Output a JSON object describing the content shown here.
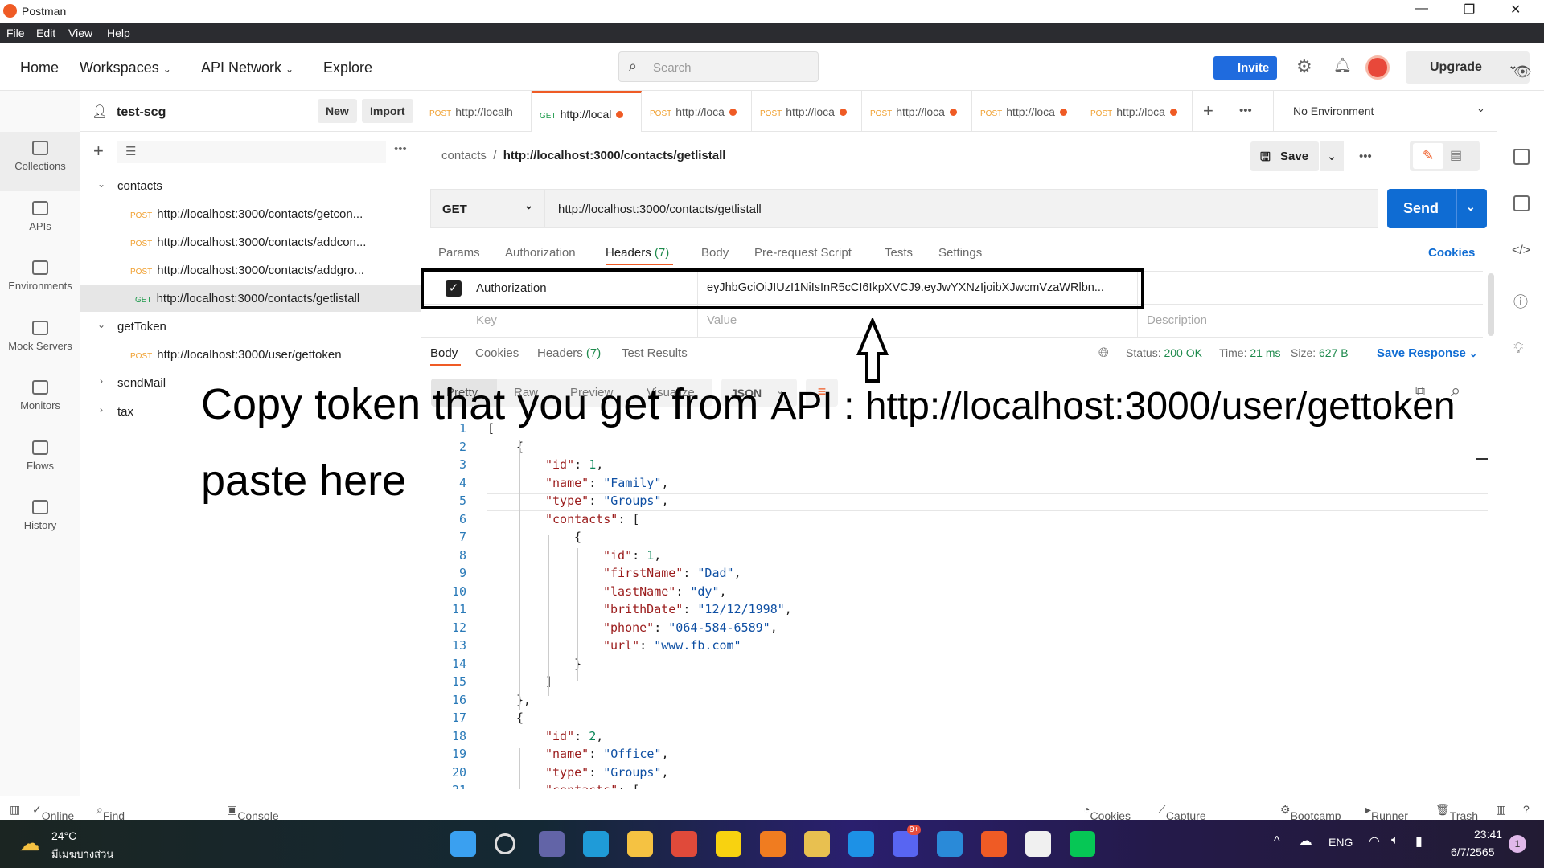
{
  "window": {
    "title": "Postman",
    "menu": [
      "File",
      "Edit",
      "View",
      "Help"
    ]
  },
  "header": {
    "nav": [
      "Home",
      "Workspaces",
      "API Network",
      "Explore"
    ],
    "search_placeholder": "Search",
    "invite": "Invite",
    "upgrade": "Upgrade"
  },
  "rail": [
    {
      "label": "Collections",
      "icon": "collections-icon"
    },
    {
      "label": "APIs",
      "icon": "apis-icon"
    },
    {
      "label": "Environments",
      "icon": "environments-icon"
    },
    {
      "label": "Mock Servers",
      "icon": "mock-servers-icon"
    },
    {
      "label": "Monitors",
      "icon": "monitors-icon"
    },
    {
      "label": "Flows",
      "icon": "flows-icon"
    },
    {
      "label": "History",
      "icon": "history-icon"
    }
  ],
  "workspace": {
    "name": "test-scg",
    "new": "New",
    "import": "Import"
  },
  "tree": [
    {
      "type": "folder",
      "label": "contacts",
      "open": true
    },
    {
      "type": "req",
      "method": "POST",
      "label": "http://localhost:3000/contacts/getcon..."
    },
    {
      "type": "req",
      "method": "POST",
      "label": "http://localhost:3000/contacts/addcon..."
    },
    {
      "type": "req",
      "method": "POST",
      "label": "http://localhost:3000/contacts/addgro..."
    },
    {
      "type": "req",
      "method": "GET",
      "label": "http://localhost:3000/contacts/getlistall",
      "selected": true
    },
    {
      "type": "folder",
      "label": "getToken",
      "open": true
    },
    {
      "type": "req",
      "method": "POST",
      "label": "http://localhost:3000/user/gettoken"
    },
    {
      "type": "folder",
      "label": "sendMail",
      "open": false
    },
    {
      "type": "folder",
      "label": "tax",
      "open": false
    }
  ],
  "tabs": [
    {
      "method": "POST",
      "label": "http://localh"
    },
    {
      "method": "GET",
      "label": "http://local",
      "active": true
    },
    {
      "method": "POST",
      "label": "http://loca"
    },
    {
      "method": "POST",
      "label": "http://loca"
    },
    {
      "method": "POST",
      "label": "http://loca"
    },
    {
      "method": "POST",
      "label": "http://loca"
    },
    {
      "method": "POST",
      "label": "http://loca"
    }
  ],
  "environment": "No Environment",
  "request": {
    "breadcrumb_parent": "contacts",
    "breadcrumb_current": "http://localhost:3000/contacts/getlistall",
    "save": "Save",
    "method": "GET",
    "url": "http://localhost:3000/contacts/getlistall",
    "send": "Send",
    "tabs": [
      "Params",
      "Authorization",
      "Headers",
      "Body",
      "Pre-request Script",
      "Tests",
      "Settings"
    ],
    "headers_count": "(7)",
    "cookies": "Cookies",
    "header_row": {
      "checked": true,
      "key": "Authorization",
      "value": "eyJhbGciOiJIUzI1NiIsInR5cCI6IkpXVCJ9.eyJwYXNzIjoibXJwcmVzaWRlbn..."
    },
    "placeholders": {
      "key": "Key",
      "value": "Value",
      "description": "Description"
    }
  },
  "response": {
    "tabs": [
      "Body",
      "Cookies",
      "Headers",
      "Test Results"
    ],
    "headers_count": "(7)",
    "status_label": "Status:",
    "status": "200 OK",
    "time_label": "Time:",
    "time": "21 ms",
    "size_label": "Size:",
    "size": "627 B",
    "save": "Save Response",
    "views": [
      "Pretty",
      "Raw",
      "Preview",
      "Visualize"
    ],
    "format": "JSON",
    "lines": [
      [
        0,
        [
          [
            "[",
            "p"
          ]
        ]
      ],
      [
        1,
        [
          [
            "{",
            "p"
          ]
        ]
      ],
      [
        2,
        [
          [
            "\"id\"",
            "k"
          ],
          [
            ": ",
            "p"
          ],
          [
            "1",
            "n"
          ],
          [
            ",",
            "p"
          ]
        ]
      ],
      [
        2,
        [
          [
            "\"name\"",
            "k"
          ],
          [
            ": ",
            "p"
          ],
          [
            "\"Family\"",
            "s"
          ],
          [
            ",",
            "p"
          ]
        ]
      ],
      [
        2,
        [
          [
            "\"type\"",
            "k"
          ],
          [
            ": ",
            "p"
          ],
          [
            "\"Groups\"",
            "s"
          ],
          [
            ",",
            "p"
          ]
        ]
      ],
      [
        2,
        [
          [
            "\"contacts\"",
            "k"
          ],
          [
            ": [",
            "p"
          ]
        ]
      ],
      [
        3,
        [
          [
            "{",
            "p"
          ]
        ]
      ],
      [
        4,
        [
          [
            "\"id\"",
            "k"
          ],
          [
            ": ",
            "p"
          ],
          [
            "1",
            "n"
          ],
          [
            ",",
            "p"
          ]
        ]
      ],
      [
        4,
        [
          [
            "\"firstName\"",
            "k"
          ],
          [
            ": ",
            "p"
          ],
          [
            "\"Dad\"",
            "s"
          ],
          [
            ",",
            "p"
          ]
        ]
      ],
      [
        4,
        [
          [
            "\"lastName\"",
            "k"
          ],
          [
            ": ",
            "p"
          ],
          [
            "\"dy\"",
            "s"
          ],
          [
            ",",
            "p"
          ]
        ]
      ],
      [
        4,
        [
          [
            "\"brithDate\"",
            "k"
          ],
          [
            ": ",
            "p"
          ],
          [
            "\"12/12/1998\"",
            "s"
          ],
          [
            ",",
            "p"
          ]
        ]
      ],
      [
        4,
        [
          [
            "\"phone\"",
            "k"
          ],
          [
            ": ",
            "p"
          ],
          [
            "\"064-584-6589\"",
            "s"
          ],
          [
            ",",
            "p"
          ]
        ]
      ],
      [
        4,
        [
          [
            "\"url\"",
            "k"
          ],
          [
            ": ",
            "p"
          ],
          [
            "\"www.fb.com\"",
            "s"
          ]
        ]
      ],
      [
        3,
        [
          [
            "}",
            "p"
          ]
        ]
      ],
      [
        2,
        [
          [
            "]",
            "p"
          ]
        ]
      ],
      [
        1,
        [
          [
            "},",
            "p"
          ]
        ]
      ],
      [
        1,
        [
          [
            "{",
            "p"
          ]
        ]
      ],
      [
        2,
        [
          [
            "\"id\"",
            "k"
          ],
          [
            ": ",
            "p"
          ],
          [
            "2",
            "n"
          ],
          [
            ",",
            "p"
          ]
        ]
      ],
      [
        2,
        [
          [
            "\"name\"",
            "k"
          ],
          [
            ": ",
            "p"
          ],
          [
            "\"Office\"",
            "s"
          ],
          [
            ",",
            "p"
          ]
        ]
      ],
      [
        2,
        [
          [
            "\"type\"",
            "k"
          ],
          [
            ": ",
            "p"
          ],
          [
            "\"Groups\"",
            "s"
          ],
          [
            ",",
            "p"
          ]
        ]
      ],
      [
        2,
        [
          [
            "\"contacts\"",
            "k"
          ],
          [
            ": [",
            "p"
          ]
        ]
      ]
    ]
  },
  "annotation": {
    "line1a": "Copy token that you get from ",
    "line1b": "API : http://localhost:3000/user/gettoken",
    "line2": "paste here"
  },
  "statusbar": {
    "left": [
      "Online",
      "Find and Replace",
      "Console"
    ],
    "right": [
      "Cookies",
      "Capture requests",
      "Bootcamp",
      "Runner",
      "Trash"
    ]
  },
  "taskbar": {
    "weather_temp": "24°C",
    "weather_desc": "มีเมฆบางส่วน",
    "lang": "ENG",
    "time": "23:41",
    "date": "6/7/2565",
    "notif": "1",
    "discord_badge": "9+",
    "apps": [
      {
        "name": "start",
        "color": "#3aa0f0"
      },
      {
        "name": "search",
        "color": "#dddddd"
      },
      {
        "name": "teams",
        "color": "#6264a7"
      },
      {
        "name": "edge",
        "color": "#1f9bd8"
      },
      {
        "name": "file-explorer",
        "color": "#f5c242"
      },
      {
        "name": "chrome",
        "color": "#e04a3a"
      },
      {
        "name": "sticky-notes",
        "color": "#f8d210"
      },
      {
        "name": "xampp",
        "color": "#f07c20"
      },
      {
        "name": "app-yellow",
        "color": "#e8c050"
      },
      {
        "name": "docker",
        "color": "#1d91e6"
      },
      {
        "name": "discord",
        "color": "#5865f2"
      },
      {
        "name": "vscode",
        "color": "#2a8ad8"
      },
      {
        "name": "postman",
        "color": "#ef5b25"
      },
      {
        "name": "ms-store",
        "color": "#f0f0f0"
      },
      {
        "name": "line",
        "color": "#06c755"
      }
    ]
  },
  "colors": {
    "accent": "#ef5b25",
    "send": "#0f6cd3",
    "status_ok": "#1e8a4c"
  }
}
